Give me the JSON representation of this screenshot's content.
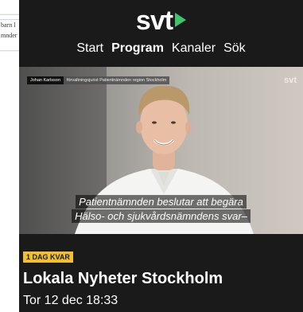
{
  "background_page": {
    "snippet_lines": [
      "barn l",
      "mnder"
    ]
  },
  "header": {
    "logo_text": "svt",
    "nav": [
      "Start",
      "Program",
      "Kanaler",
      "Sök"
    ],
    "active_nav": "Program"
  },
  "video": {
    "lower_third_name": "Johan Karlsson",
    "lower_third_title": "förvaltningsjurist Patientnämnden region Stockholm",
    "watermark": "svt",
    "subtitle_line1": "Patientnämnden beslutar att begära",
    "subtitle_line2": "Hälso- och sjukvårdsnämndens svar–"
  },
  "program": {
    "badge": "1 DAG KVAR",
    "title": "Lokala Nyheter Stockholm",
    "airtime": "Tor 12 dec 18:33"
  },
  "colors": {
    "panel_bg": "#1a1a1a",
    "accent_green": "#3fc46e",
    "badge_yellow": "#f0c030"
  }
}
